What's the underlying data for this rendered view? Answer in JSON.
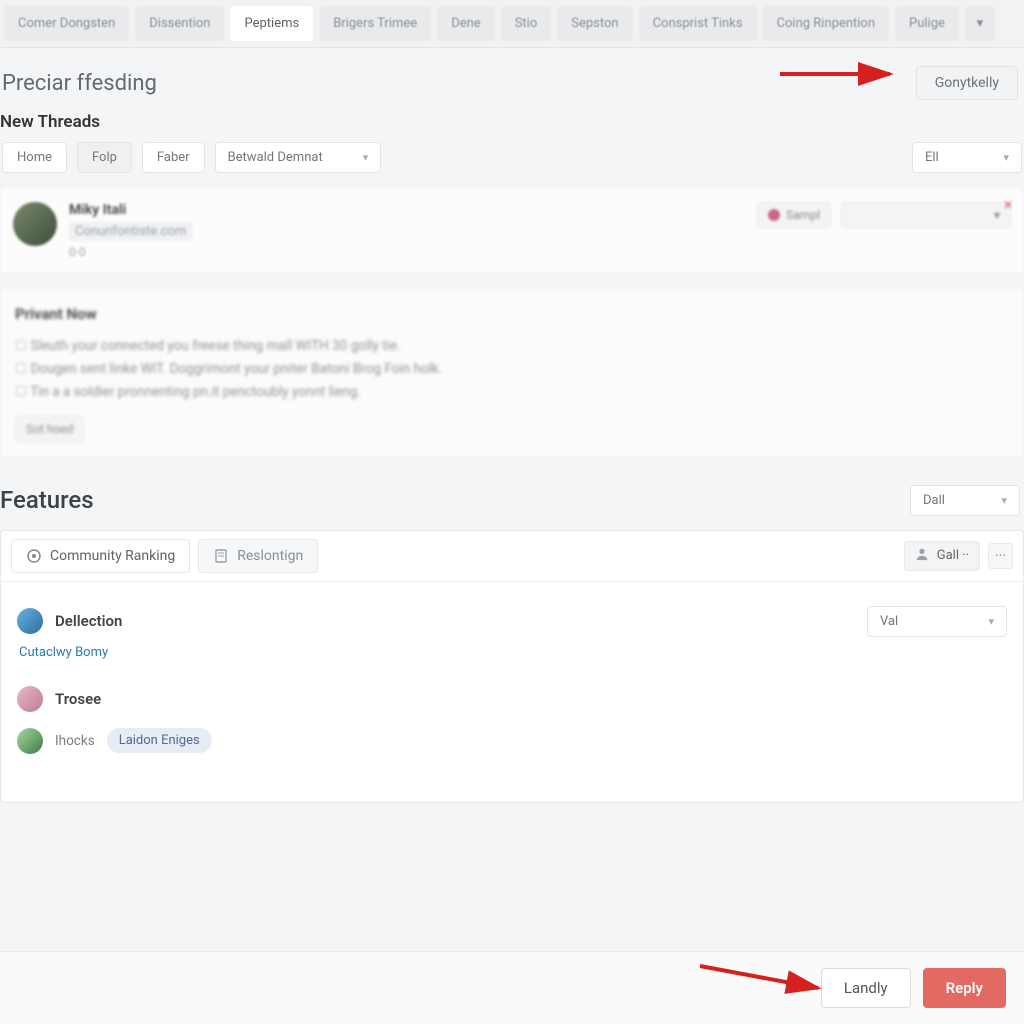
{
  "tabs": {
    "items": [
      {
        "label": "Comer Dongsten"
      },
      {
        "label": "Dissention"
      },
      {
        "label": "Peptiems"
      },
      {
        "label": "Brigers Trimee"
      },
      {
        "label": "Dene"
      },
      {
        "label": "Stio"
      },
      {
        "label": "Sepston"
      },
      {
        "label": "Consprist Tinks"
      },
      {
        "label": "Coing Rinpention"
      },
      {
        "label": "Pulige"
      }
    ],
    "active_index": 2,
    "more_glyph": "▾"
  },
  "page_title": "Preciar ffesding",
  "top_right_button": "Gonytkelly",
  "new_threads": {
    "heading": "New Threads",
    "filters": {
      "home": "Home",
      "folp": "Folp",
      "faber": "Faber"
    },
    "sort_select": "Betwald Demnat",
    "right_select": "Ell",
    "thread": {
      "name": "Miky Itali",
      "sub": "Conurifontiste.com",
      "extra": "0·0",
      "chip": "Sampl",
      "dropdown_placeholder": " ",
      "close_glyph": "✕"
    }
  },
  "private_now": {
    "heading": "Privant Now",
    "lines": [
      "Sleuth your connected you freese thing mall WITH 30 golly tie.",
      "Dougen sent linke WIT. Doggrimont your pniter Batoni Brog Foin holk.",
      "Tin a a soldier pronnenting pn.it penctoubly yonnt lieng."
    ],
    "button": "Sot hoed"
  },
  "features": {
    "heading": "Features",
    "right_select": "Dall",
    "panel_tabs": {
      "ranking": "Community Ranking",
      "second": "Reslontign"
    },
    "user_chip": "Gall ··",
    "dots": "···",
    "row1": {
      "name": "Dellection",
      "select": "Val"
    },
    "link": "Cutaclwy Bomy",
    "row2": {
      "name": "Trosee"
    },
    "row3": {
      "text": "Ihocks",
      "tag": "Laidon Eniges"
    }
  },
  "footer": {
    "secondary": "Landly",
    "primary": "Reply"
  },
  "colors": {
    "accent": "#e26a62",
    "arrow": "#d62020"
  }
}
